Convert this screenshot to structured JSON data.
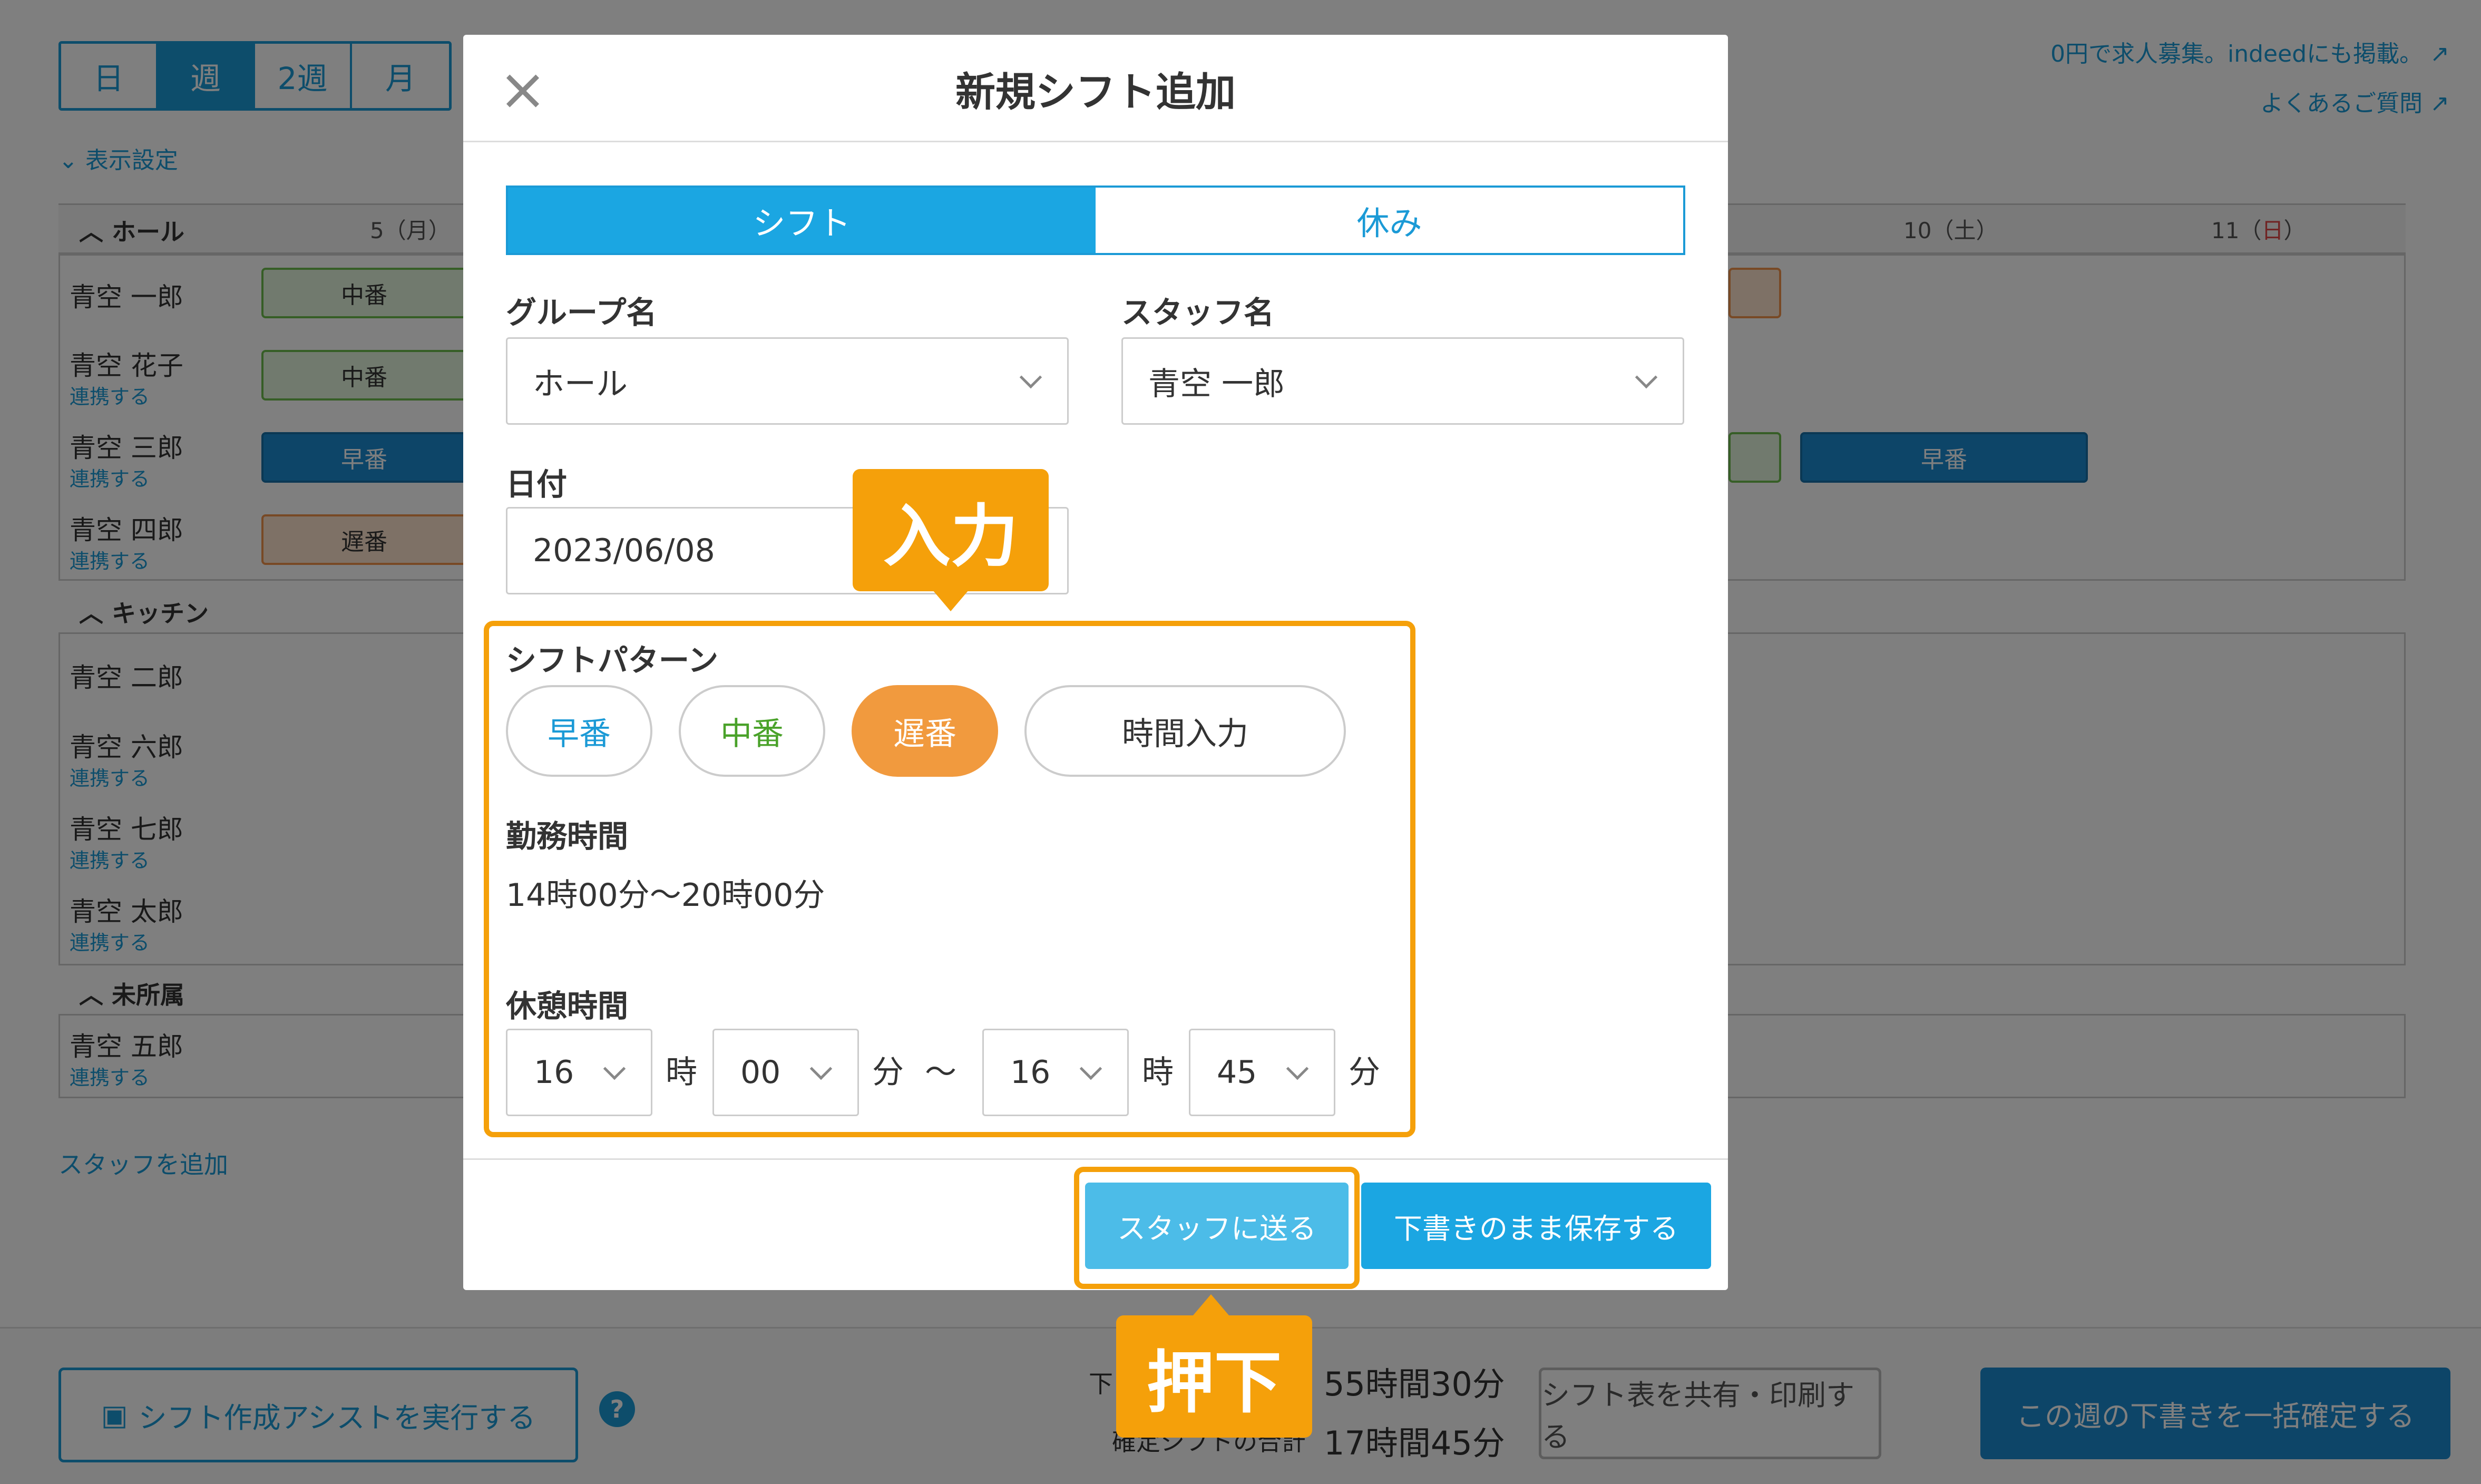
{
  "view_tabs": [
    "日",
    "週",
    "2週",
    "月"
  ],
  "display_settings": "表示設定",
  "top_links": {
    "job_ad": "0円で求人募集。indeedにも掲載。",
    "faq": "よくあるご質問"
  },
  "schedule": {
    "day_headers": [
      "5（月）",
      "10（土）",
      "11（",
      "日",
      "）"
    ],
    "groups": [
      {
        "label": "ホール"
      },
      {
        "label": "キッチン"
      },
      {
        "label": "未所属"
      }
    ],
    "staff": [
      {
        "name": "青空 一郎",
        "link": ""
      },
      {
        "name": "青空 花子",
        "link": "連携する"
      },
      {
        "name": "青空 三郎",
        "link": "連携する"
      },
      {
        "name": "青空 四郎",
        "link": "連携する"
      },
      {
        "name": "青空 二郎",
        "link": ""
      },
      {
        "name": "青空 六郎",
        "link": "連携する"
      },
      {
        "name": "青空 七郎",
        "link": "連携する"
      },
      {
        "name": "青空 太郎",
        "link": "連携する"
      },
      {
        "name": "青空 五郎",
        "link": "連携する"
      }
    ],
    "chips": [
      "中番",
      "中番",
      "早番",
      "遅番",
      "早番"
    ],
    "add_staff": "スタッフを追加"
  },
  "bottom_bar": {
    "assist_button": "シフト作成アシストを実行する",
    "help_icon": "?",
    "draft_total_label": "下",
    "draft_total_value": "55時間30分",
    "confirmed_total_label": "確定シフトの合計",
    "confirmed_total_value": "17時間45分",
    "share_button": "シフト表を共有・印刷する",
    "confirm_button": "この週の下書きを一括確定する"
  },
  "modal": {
    "title": "新規シフト追加",
    "close_icon": "×",
    "tabs": [
      "シフト",
      "休み"
    ],
    "group_label": "グループ名",
    "group_value": "ホール",
    "staff_label": "スタッフ名",
    "staff_value": "青空 一郎",
    "date_label": "日付",
    "date_value": "2023/06/08",
    "pattern_label": "シフトパターン",
    "patterns": [
      "早番",
      "中番",
      "遅番",
      "時間入力"
    ],
    "pattern_colors": {
      "early": "#1b9ad6",
      "middle": "#4aa22a",
      "late_selected": "#f19a3e"
    },
    "work_time_label": "勤務時間",
    "work_time_value": "14時00分〜20時00分",
    "break_label": "休憩時間",
    "break_start_hour": "16",
    "break_start_min": "00",
    "break_end_hour": "16",
    "break_end_min": "45",
    "unit_hour": "時",
    "unit_min": "分",
    "tilde": "〜",
    "send_button": "スタッフに送る",
    "save_draft_button": "下書きのまま保存する"
  },
  "annotations": {
    "input": "入力",
    "press": "押下",
    "accent": "#f5a00a"
  }
}
